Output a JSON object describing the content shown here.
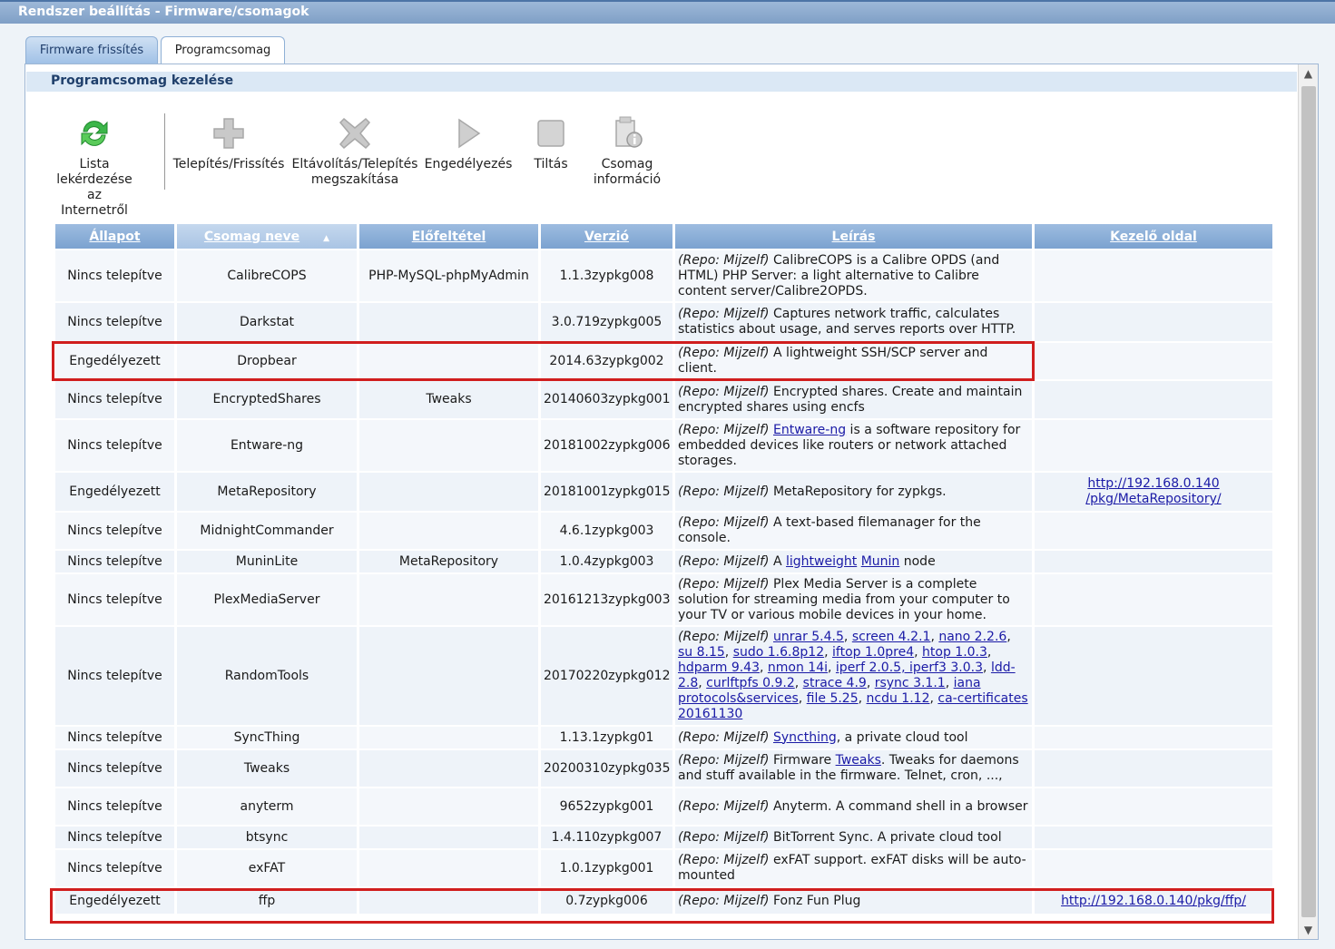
{
  "window": {
    "title": "Rendszer beállítás - Firmware/csomagok"
  },
  "tabs": [
    {
      "label": "Firmware frissítés",
      "active": false
    },
    {
      "label": "Programcsomag",
      "active": true
    }
  ],
  "panel": {
    "header": "Programcsomag kezelése"
  },
  "toolbar": {
    "refresh": {
      "line1": "Lista",
      "line2": "lekérdezése",
      "line3": "az",
      "line4": "Internetről",
      "icon": "refresh-icon"
    },
    "install": {
      "label": "Telepítés/Frissítés",
      "icon": "plus-icon"
    },
    "remove": {
      "line1": "Eltávolítás/Telepítés",
      "line2": "megszakítása",
      "icon": "remove-x-icon"
    },
    "enable": {
      "label": "Engedélyezés",
      "icon": "play-icon"
    },
    "disable": {
      "label": "Tiltás",
      "icon": "stop-icon"
    },
    "info": {
      "line1": "Csomag",
      "line2": "információ",
      "icon": "package-info-icon"
    }
  },
  "table": {
    "headers": {
      "status": "Állapot",
      "name": "Csomag neve",
      "prereq": "Előfeltétel",
      "version": "Verzió",
      "description": "Leírás",
      "mgmt": "Kezelő oldal"
    },
    "sorted_column": "name",
    "rows": [
      {
        "status": "Nincs telepítve",
        "name": "CalibreCOPS",
        "prereq": "PHP-MySQL-phpMyAdmin",
        "version": "1.1.3zypkg008",
        "repo": "(Repo: Mijzelf)",
        "desc": " CalibreCOPS is a Calibre OPDS (and HTML) PHP Server: a light alternative to Calibre content server/Calibre2OPDS.",
        "mgmt1": "",
        "mgmt2": ""
      },
      {
        "status": "Nincs telepítve",
        "name": "Darkstat",
        "prereq": "",
        "version": "3.0.719zypkg005",
        "repo": "(Repo: Mijzelf)",
        "desc": " Captures network traffic, calculates statistics about usage, and serves reports over HTTP.",
        "mgmt1": "",
        "mgmt2": ""
      },
      {
        "status": "Engedélyezett",
        "name": "Dropbear",
        "prereq": "",
        "version": "2014.63zypkg002",
        "repo": "(Repo: Mijzelf)",
        "desc": " A lightweight SSH/SCP server and client.",
        "mgmt1": "",
        "mgmt2": ""
      },
      {
        "status": "Nincs telepítve",
        "name": "EncryptedShares",
        "prereq": "Tweaks",
        "version": "20140603zypkg001",
        "repo": "(Repo: Mijzelf)",
        "desc": " Encrypted shares. Create and maintain encrypted shares using encfs",
        "mgmt1": "",
        "mgmt2": ""
      },
      {
        "status": "Nincs telepítve",
        "name": "Entware-ng",
        "prereq": "",
        "version": "20181002zypkg006",
        "repo": "(Repo: Mijzelf)",
        "link": "Entware-ng",
        "desc": " is a software repository for embedded devices like routers or network attached storages.",
        "mgmt1": "",
        "mgmt2": ""
      },
      {
        "status": "Engedélyezett",
        "name": "MetaRepository",
        "prereq": "",
        "version": "20181001zypkg015",
        "repo": "(Repo: Mijzelf)",
        "desc": " MetaRepository for zypkgs.",
        "mgmt1": "http://192.168.0.140",
        "mgmt2": "/pkg/MetaRepository/"
      },
      {
        "status": "Nincs telepítve",
        "name": "MidnightCommander",
        "prereq": "",
        "version": "4.6.1zypkg003",
        "repo": "(Repo: Mijzelf)",
        "desc": " A text-based filemanager for the console.",
        "mgmt1": "",
        "mgmt2": ""
      },
      {
        "status": "Nincs telepítve",
        "name": "MuninLite",
        "prereq": "MetaRepository",
        "version": "1.0.4zypkg003",
        "repo": "(Repo: Mijzelf)",
        "pre": " A ",
        "link": "lightweight",
        "link2": "Munin",
        "desc": " node",
        "mgmt1": "",
        "mgmt2": ""
      },
      {
        "status": "Nincs telepítve",
        "name": "PlexMediaServer",
        "prereq": "",
        "version": "20161213zypkg003",
        "repo": "(Repo: Mijzelf)",
        "desc": " Plex Media Server is a complete solution for streaming media from your computer to your TV or various mobile devices in your home.",
        "mgmt1": "",
        "mgmt2": ""
      },
      {
        "status": "Nincs telepítve",
        "name": "RandomTools",
        "prereq": "",
        "version": "20170220zypkg012",
        "repo": "(Repo: Mijzelf)",
        "links": [
          "unrar 5.4.5",
          "screen 4.2.1",
          "nano 2.2.6",
          "su 8.15",
          "sudo 1.6.8p12",
          "iftop 1.0pre4",
          "htop 1.0.3",
          "hdparm 9.43",
          "nmon 14i",
          "iperf 2.0.5, iperf3 3.0.3",
          "ldd-2.8",
          "curlftpfs 0.9.2",
          "strace 4.9",
          "rsync 3.1.1",
          "iana protocols&services",
          "file 5.25",
          "ncdu 1.12",
          "ca-certificates 20161130"
        ],
        "mgmt1": "",
        "mgmt2": ""
      },
      {
        "status": "Nincs telepítve",
        "name": "SyncThing",
        "prereq": "",
        "version": "1.13.1zypkg01",
        "repo": "(Repo: Mijzelf)",
        "link": "Syncthing",
        "desc": ", a private cloud tool",
        "mgmt1": "",
        "mgmt2": ""
      },
      {
        "status": "Nincs telepítve",
        "name": "Tweaks",
        "prereq": "",
        "version": "20200310zypkg035",
        "repo": "(Repo: Mijzelf)",
        "pre": " Firmware ",
        "link": "Tweaks",
        "desc": ". Tweaks for daemons and stuff available in the firmware. Telnet, cron, ...,",
        "mgmt1": "",
        "mgmt2": ""
      },
      {
        "status": "Nincs telepítve",
        "name": "anyterm",
        "prereq": "",
        "version": "9652zypkg001",
        "repo": "(Repo: Mijzelf)",
        "desc": " Anyterm. A command shell in a browser",
        "mgmt1": "",
        "mgmt2": ""
      },
      {
        "status": "Nincs telepítve",
        "name": "btsync",
        "prereq": "",
        "version": "1.4.110zypkg007",
        "repo": "(Repo: Mijzelf)",
        "desc": " BitTorrent Sync. A private cloud tool",
        "mgmt1": "",
        "mgmt2": ""
      },
      {
        "status": "Nincs telepítve",
        "name": "exFAT",
        "prereq": "",
        "version": "1.0.1zypkg001",
        "repo": "(Repo: Mijzelf)",
        "desc": " exFAT support. exFAT disks will be auto-mounted",
        "mgmt1": "",
        "mgmt2": ""
      },
      {
        "status": "Engedélyezett",
        "name": "ffp",
        "prereq": "",
        "version": "0.7zypkg006",
        "repo": "(Repo: Mijzelf)",
        "desc": " Fonz Fun Plug",
        "mgmt1": "http://192.168.0.140/pkg/ffp/",
        "mgmt2": ""
      }
    ]
  },
  "highlight_color": "#d01e1e"
}
